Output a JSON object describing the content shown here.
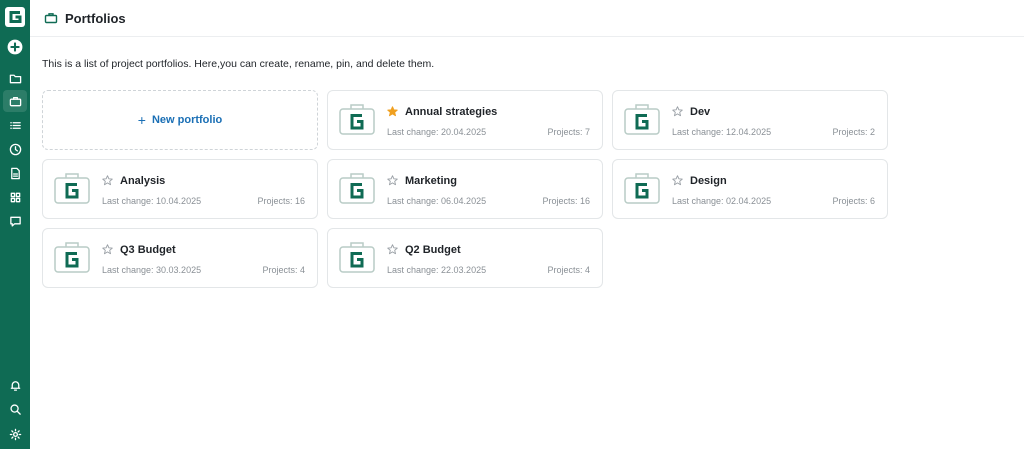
{
  "app": {
    "logo_icon": "app-logo-g-icon",
    "accent": "#0f6b54",
    "link_color": "#1a6fb5"
  },
  "sidebar": {
    "top_items": [
      {
        "icon": "plus-circle-icon",
        "label": "Create"
      },
      {
        "icon": "folder-icon",
        "label": "Projects"
      },
      {
        "icon": "briefcase-icon",
        "label": "Portfolios"
      },
      {
        "icon": "list-icon",
        "label": "Tasks"
      },
      {
        "icon": "clock-icon",
        "label": "Time"
      },
      {
        "icon": "document-icon",
        "label": "Documents"
      },
      {
        "icon": "apps-grid-icon",
        "label": "Apps"
      },
      {
        "icon": "chat-icon",
        "label": "Messages"
      }
    ],
    "bottom_items": [
      {
        "icon": "bell-icon",
        "label": "Notifications"
      },
      {
        "icon": "search-icon",
        "label": "Search"
      },
      {
        "icon": "gear-icon",
        "label": "Settings"
      }
    ]
  },
  "header": {
    "title": "Portfolios",
    "icon": "briefcase-icon"
  },
  "intro": "This is a list of project portfolios. Here,you can create, rename, pin, and delete them.",
  "new_portfolio": {
    "plus": "+",
    "label": "New portfolio"
  },
  "portfolios": [
    {
      "name": "Annual strategies",
      "last_change": "Last change: 20.04.2025",
      "projects": "Projects: 7",
      "pinned": true
    },
    {
      "name": "Dev",
      "last_change": "Last change: 12.04.2025",
      "projects": "Projects: 2",
      "pinned": false
    },
    {
      "name": "Analysis",
      "last_change": "Last change: 10.04.2025",
      "projects": "Projects: 16",
      "pinned": false
    },
    {
      "name": "Marketing",
      "last_change": "Last change: 06.04.2025",
      "projects": "Projects: 16",
      "pinned": false
    },
    {
      "name": "Design",
      "last_change": "Last change: 02.04.2025",
      "projects": "Projects: 6",
      "pinned": false
    },
    {
      "name": "Q3 Budget",
      "last_change": "Last change: 30.03.2025",
      "projects": "Projects: 4",
      "pinned": false
    },
    {
      "name": "Q2 Budget",
      "last_change": "Last change: 22.03.2025",
      "projects": "Projects: 4",
      "pinned": false
    }
  ],
  "colors": {
    "star_pinned": "#f0a020",
    "star_unpinned": "#9aa0a6"
  }
}
